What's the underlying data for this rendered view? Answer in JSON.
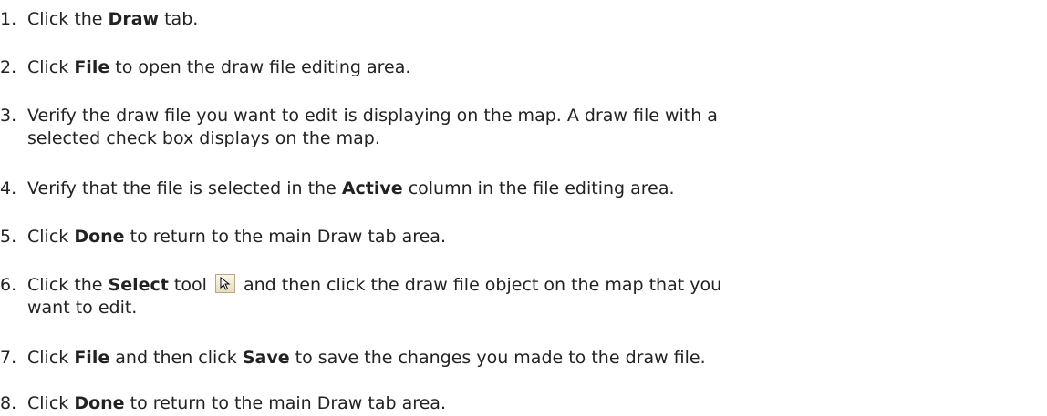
{
  "steps": [
    {
      "num": "1.",
      "t1": "Click the ",
      "b1": "Draw",
      "t2": " tab."
    },
    {
      "num": "2.",
      "t1": "Click ",
      "b1": "File",
      "t2": " to open the draw file editing area."
    },
    {
      "num": "3.",
      "line1": "Verify the draw file you want to edit is displaying on the map. A draw file with a",
      "line2": "selected check box displays on the map."
    },
    {
      "num": "4.",
      "t1": "Verify that the file is selected in the ",
      "b1": "Active",
      "t2": " column in the file editing area."
    },
    {
      "num": "5.",
      "t1": "Click ",
      "b1": "Done",
      "t2": " to return to the main Draw tab area."
    },
    {
      "num": "6.",
      "t1": "Click the ",
      "b1": "Select",
      "t2": " tool ",
      "t3": " and then click the draw file object on the map that you",
      "line2": "want to edit.",
      "icon": "select-arrow-icon"
    },
    {
      "num": "7.",
      "t1": "Click ",
      "b1": "File",
      "t2": " and then click ",
      "b2": "Save",
      "t3": " to save the changes you made to the draw file."
    },
    {
      "num": "8.",
      "t1": "Click ",
      "b1": "Done",
      "t2": " to return to the main Draw tab area."
    }
  ]
}
